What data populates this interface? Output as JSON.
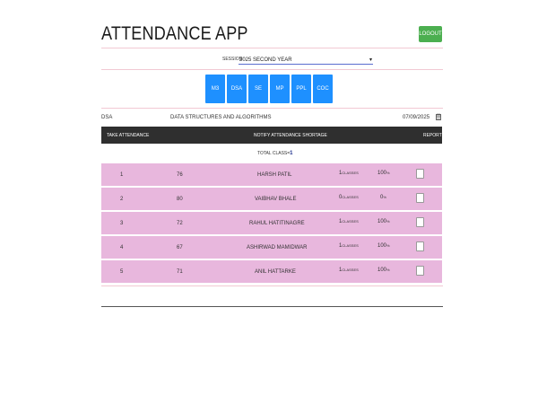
{
  "header": {
    "title": "ATTENDANCE APP",
    "logout_label": "LOGOUT"
  },
  "session": {
    "label": "SESSION:",
    "value": "2025 SECOND YEAR"
  },
  "subjects": [
    "M3",
    "DSA",
    "SE",
    "MP",
    "PPL",
    "COC"
  ],
  "course": {
    "code": "DSA",
    "name": "DATA STRUCTURES AND ALGORITHMS",
    "date": "07/09/2025"
  },
  "table": {
    "headers": {
      "take": "TAKE ATTENDANCE",
      "notify": "NOTIFY ATTENDANCE SHORTAGE",
      "report": "REPORT"
    },
    "total_label": "TOTAL CLASS=",
    "total_value": "1",
    "rows": [
      {
        "sr": "1",
        "roll": "76",
        "name": "HARSH PATIL",
        "classes": "1",
        "classes_unit": "CLASSES",
        "percent": "100",
        "percent_unit": "%"
      },
      {
        "sr": "2",
        "roll": "80",
        "name": "VAIBHAV BHALE",
        "classes": "0",
        "classes_unit": "CLASSES",
        "percent": "0",
        "percent_unit": "%"
      },
      {
        "sr": "3",
        "roll": "72",
        "name": "RAHUL HATITINAGRE",
        "classes": "1",
        "classes_unit": "CLASSES",
        "percent": "100",
        "percent_unit": "%"
      },
      {
        "sr": "4",
        "roll": "67",
        "name": "ASHIRWAD MAMIDWAR",
        "classes": "1",
        "classes_unit": "CLASSES",
        "percent": "100",
        "percent_unit": "%"
      },
      {
        "sr": "5",
        "roll": "71",
        "name": "ANIL HATTARKE",
        "classes": "1",
        "classes_unit": "CLASSES",
        "percent": "100",
        "percent_unit": "%"
      }
    ]
  },
  "icons": {
    "calendar": "calendar-icon",
    "dropdown": "chevron-down-icon"
  },
  "colors": {
    "logout": "#4caf50",
    "subject": "#1e90ff",
    "row": "#e8b7dd",
    "table_head": "#2f2f2f"
  }
}
